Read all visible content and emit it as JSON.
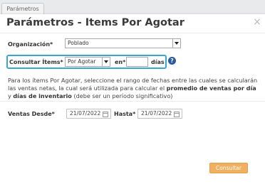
{
  "background_tab": {
    "label": "Parámetros"
  },
  "modal": {
    "title": "Parámetros - Items Por Agotar",
    "close_icon": "×"
  },
  "organizacion": {
    "label": "Organización*",
    "value": "Poblado"
  },
  "consultar": {
    "label": "Consultar Ítems*",
    "value": "Por Agotar",
    "en_label": "en*",
    "dias_value": "",
    "dias_label": "días",
    "help_icon": "?"
  },
  "info": {
    "part1": "Para los ítems Por Agotar, seleccione el rango de fechas entre las cuales se calcularán las ventas netas, la cual será utilizada para calcular el ",
    "bold": "promedio de ventas por día",
    "part2": " y ",
    "bold2": "días de inventario",
    "part3": " (debe ser un período significativo)"
  },
  "ventas": {
    "desde_label": "Ventas Desde*",
    "desde_value": "21/07/2022",
    "hasta_label": "Hasta*",
    "hasta_value": "21/07/2022"
  },
  "actions": {
    "consultar_button": "Consultar"
  },
  "colors": {
    "highlight": "#3aa6d0",
    "button": "#f0b060",
    "help": "#2c5aa0"
  }
}
